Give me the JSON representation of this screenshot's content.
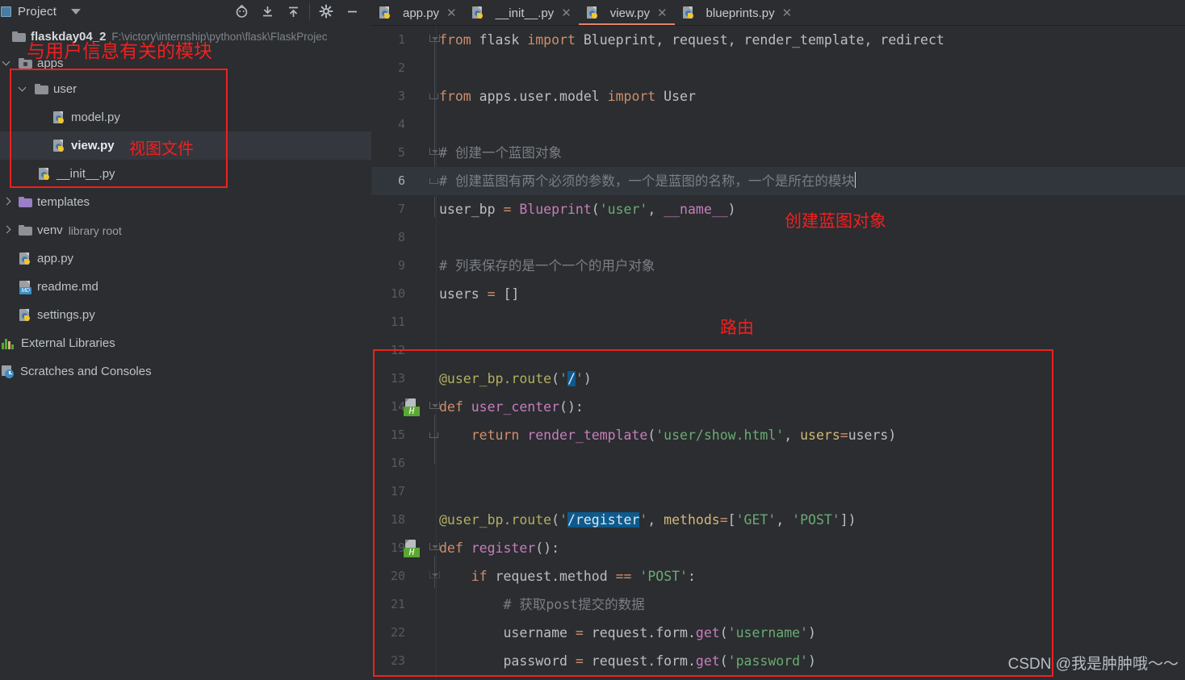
{
  "window": {
    "theme_bg": "#2b2d30",
    "accent": "#e5836a",
    "annotation_color": "#f02020"
  },
  "sidebar": {
    "header": {
      "title": "Project",
      "caret_icon": "chevron-down-icon",
      "tools": [
        {
          "name": "locate-icon",
          "glyph": "⊕"
        },
        {
          "name": "collapse-all-icon",
          "glyph": "⤓"
        },
        {
          "name": "expand-all-icon",
          "glyph": "⤒"
        },
        {
          "name": "settings-gear-icon",
          "glyph": "⚙"
        },
        {
          "name": "hide-panel-icon",
          "glyph": "—"
        }
      ]
    },
    "tree": [
      {
        "id": "project-root",
        "depth": 0,
        "twisty": "none",
        "icon": "folder-icon",
        "label": "flaskday04_2",
        "bold": true,
        "path": "F:\\victory\\internship\\python\\flask\\FlaskProjec"
      },
      {
        "id": "apps",
        "depth": 0,
        "twisty": "open",
        "icon": "source-folder-icon",
        "label": "apps"
      },
      {
        "id": "user",
        "depth": 1,
        "twisty": "open",
        "icon": "folder-icon",
        "label": "user"
      },
      {
        "id": "model-py",
        "depth": 2,
        "twisty": "none",
        "icon": "python-file-icon",
        "label": "model.py"
      },
      {
        "id": "view-py",
        "depth": 2,
        "twisty": "none",
        "icon": "python-file-icon",
        "label": "view.py",
        "selected": true,
        "white": true
      },
      {
        "id": "init-py",
        "depth": 2,
        "twisty": "none",
        "icon": "python-file-icon",
        "label": "__init__.py",
        "shiftleft": true
      },
      {
        "id": "templates",
        "depth": 0,
        "twisty": "closed",
        "icon": "templates-folder-icon",
        "label": "templates"
      },
      {
        "id": "venv",
        "depth": 0,
        "twisty": "closed",
        "icon": "folder-icon",
        "label": "venv",
        "tag": "library root"
      },
      {
        "id": "app-py",
        "depth": 0,
        "twisty": "none",
        "icon": "python-file-icon",
        "label": "app.py"
      },
      {
        "id": "readme-md",
        "depth": 0,
        "twisty": "none",
        "icon": "markdown-file-icon",
        "label": "readme.md"
      },
      {
        "id": "settings-py",
        "depth": 0,
        "twisty": "none",
        "icon": "python-file-icon",
        "label": "settings.py"
      },
      {
        "id": "external-libraries",
        "depth": 0,
        "twisty": "none",
        "icon": "external-libraries-icon",
        "label": "External Libraries"
      },
      {
        "id": "scratches",
        "depth": 0,
        "twisty": "none",
        "icon": "scratches-icon",
        "label": "Scratches and Consoles"
      }
    ],
    "annotations": {
      "module_note": "与用户信息有关的模块",
      "view_note": "视图文件"
    }
  },
  "editor": {
    "tabs": [
      {
        "label": "app.py",
        "icon": "python-file-icon",
        "close_icon": "close-icon",
        "active": false
      },
      {
        "label": "__init__.py",
        "icon": "python-file-icon",
        "close_icon": "close-icon",
        "active": false
      },
      {
        "label": "view.py",
        "icon": "python-file-icon",
        "close_icon": "close-icon",
        "active": true
      },
      {
        "label": "blueprints.py",
        "icon": "python-file-icon",
        "close_icon": "close-icon",
        "active": false
      }
    ],
    "annotations": {
      "blueprint_note": "创建蓝图对象",
      "route_note": "路由"
    },
    "lines": [
      {
        "n": 1,
        "text": "from flask import Blueprint, request, render_template, redirect"
      },
      {
        "n": 2,
        "text": ""
      },
      {
        "n": 3,
        "text": "from apps.user.model import User"
      },
      {
        "n": 4,
        "text": ""
      },
      {
        "n": 5,
        "text": "# 创建一个蓝图对象"
      },
      {
        "n": 6,
        "text": "# 创建蓝图有两个必须的参数，一个是蓝图的名称，一个是所在的模块",
        "current": true
      },
      {
        "n": 7,
        "text": "user_bp = Blueprint('user', __name__)"
      },
      {
        "n": 8,
        "text": ""
      },
      {
        "n": 9,
        "text": "# 列表保存的是一个一个的用户对象"
      },
      {
        "n": 10,
        "text": "users = []"
      },
      {
        "n": 11,
        "text": ""
      },
      {
        "n": 12,
        "text": ""
      },
      {
        "n": 13,
        "text": "@user_bp.route('/')"
      },
      {
        "n": 14,
        "text": "def user_center():",
        "gutter_badge": "html-reference-icon"
      },
      {
        "n": 15,
        "text": "    return render_template('user/show.html', users=users)"
      },
      {
        "n": 16,
        "text": ""
      },
      {
        "n": 17,
        "text": ""
      },
      {
        "n": 18,
        "text": "@user_bp.route('/register', methods=['GET', 'POST'])"
      },
      {
        "n": 19,
        "text": "def register():",
        "gutter_badge": "html-reference-icon"
      },
      {
        "n": 20,
        "text": "    if request.method == 'POST':"
      },
      {
        "n": 21,
        "text": "        # 获取post提交的数据"
      },
      {
        "n": 22,
        "text": "        username = request.form.get('username')"
      },
      {
        "n": 23,
        "text": "        password = request.form.get('password')"
      }
    ],
    "search_highlights": [
      "/",
      "/register"
    ]
  },
  "watermark": "CSDN @我是肿肿哦～～"
}
